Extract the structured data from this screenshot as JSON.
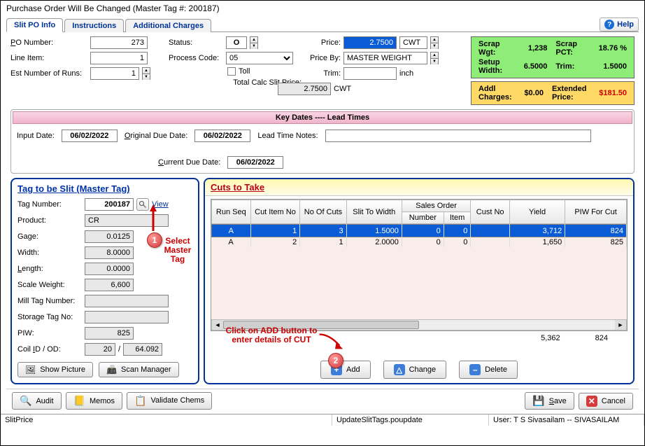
{
  "window": {
    "title": "Purchase Order Will Be Changed  (Master Tag #: 200187)"
  },
  "tabs": {
    "slit": "Slit PO Info",
    "instructions": "Instructions",
    "addl": "Additional Charges"
  },
  "help": {
    "label": "Help"
  },
  "form": {
    "po_label": "PO Number:",
    "po_value": "273",
    "line_label": "Line Item:",
    "line_value": "1",
    "runs_label": "Est Number of Runs:",
    "runs_value": "1",
    "status_label": "Status:",
    "status_value": "O",
    "proc_label": "Process Code:",
    "proc_value": "05",
    "toll_label": "Toll",
    "calc_label": "Total Calc Slit Price:",
    "calc_value": "2.7500",
    "calc_unit": "CWT",
    "price_label": "Price:",
    "price_value": "2.7500",
    "price_unit": "CWT",
    "priceby_label": "Price By:",
    "priceby_value": "MASTER WEIGHT",
    "trim_label": "Trim:",
    "trim_value": "",
    "trim_unit": "inch"
  },
  "summary": {
    "scrap_wgt_lbl": "Scrap Wgt:",
    "scrap_wgt": "1,238",
    "scrap_pct_lbl": "Scrap PCT:",
    "scrap_pct": "18.76 %",
    "setup_w_lbl": "Setup Width:",
    "setup_w": "6.5000",
    "trim_lbl": "Trim:",
    "trim": "1.5000",
    "addl_lbl": "Addl Charges:",
    "addl": "$0.00",
    "ext_lbl": "Extended Price:",
    "ext": "$181.50"
  },
  "keydates": {
    "title": "Key Dates ---- Lead Times",
    "input_lbl": "Input Date:",
    "input_val": "06/02/2022",
    "orig_lbl": "Original Due Date:",
    "orig_val": "06/02/2022",
    "curr_lbl": "Current Due Date:",
    "curr_val": "06/02/2022",
    "notes_lbl": "Lead Time Notes:",
    "notes_val": ""
  },
  "master": {
    "title": "Tag to be Slit (Master Tag)",
    "tag_lbl": "Tag Number:",
    "tag_val": "200187",
    "view": "View",
    "product_lbl": "Product:",
    "product_val": "CR",
    "gage_lbl": "Gage:",
    "gage_val": "0.0125",
    "width_lbl": "Width:",
    "width_val": "8.0000",
    "length_lbl": "Length:",
    "length_val": "0.0000",
    "scale_lbl": "Scale Weight:",
    "scale_val": "6,600",
    "mill_lbl": "Mill Tag Number:",
    "mill_val": "",
    "storage_lbl": "Storage Tag No:",
    "storage_val": "",
    "piw_lbl": "PIW:",
    "piw_val": "825",
    "coil_lbl": "Coil ID / OD:",
    "coil_id": "20",
    "coil_sep": "/",
    "coil_od": "64.092",
    "show_pic": "Show Picture",
    "scan_mgr": "Scan Manager"
  },
  "cuts": {
    "title": "Cuts to Take",
    "cols": {
      "runseq": "Run Seq",
      "cutitem": "Cut Item No",
      "noof": "No Of Cuts",
      "slitw": "Slit To Width",
      "sogroup": "Sales Order",
      "sonum": "Number",
      "soitem": "Item",
      "cust": "Cust No",
      "yield": "Yield",
      "piw": "PIW For Cut"
    },
    "rows": [
      {
        "seq": "A",
        "item": "1",
        "noof": "3",
        "width": "1.5000",
        "sonum": "0",
        "soitem": "0",
        "cust": "",
        "yield": "3,712",
        "piw": "824"
      },
      {
        "seq": "A",
        "item": "2",
        "noof": "1",
        "width": "2.0000",
        "sonum": "0",
        "soitem": "0",
        "cust": "",
        "yield": "1,650",
        "piw": "825"
      }
    ],
    "totals": {
      "yield": "5,362",
      "piw": "824"
    },
    "add": "Add",
    "change": "Change",
    "delete": "Delete"
  },
  "annotations": {
    "select_master": "Select Master Tag",
    "add_instr": "Click on ADD button to enter details of CUT"
  },
  "bottom": {
    "audit": "Audit",
    "memos": "Memos",
    "validate": "Validate Chems",
    "save": "Save",
    "cancel": "Cancel"
  },
  "status": {
    "left": "SlitPrice",
    "mid": "UpdateSlitTags.poupdate",
    "right": "User: T S Sivasailam -- SIVASAILAM"
  }
}
